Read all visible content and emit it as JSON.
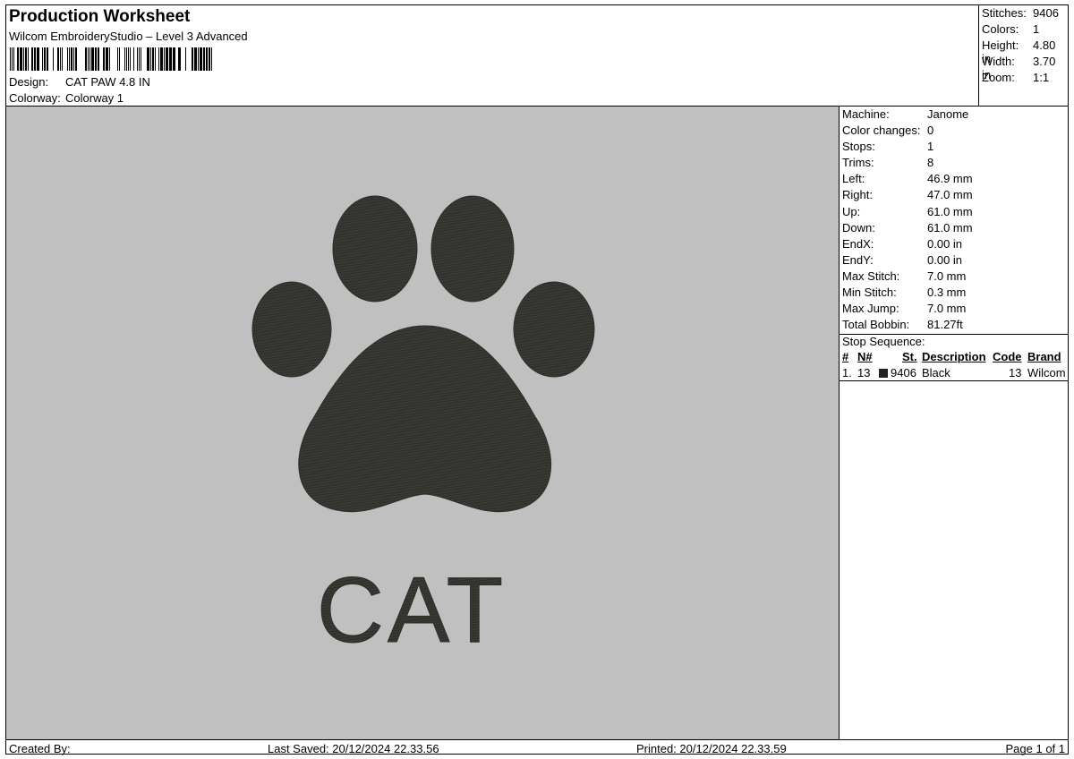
{
  "header": {
    "title": "Production Worksheet",
    "software": "Wilcom EmbroideryStudio – Level 3 Advanced",
    "design_label": "Design:",
    "design_value": "CAT PAW 4.8 IN",
    "colorway_label": "Colorway:",
    "colorway_value": "Colorway 1"
  },
  "stats": [
    {
      "label": "Stitches:",
      "value": "9406"
    },
    {
      "label": "Colors:",
      "value": "1"
    },
    {
      "label": "Height:",
      "value": "4.80 in"
    },
    {
      "label": "Width:",
      "value": "3.70 in"
    },
    {
      "label": "Zoom:",
      "value": "1:1"
    }
  ],
  "params": [
    {
      "label": "Machine:",
      "value": "Janome"
    },
    {
      "label": "Color changes:",
      "value": "0"
    },
    {
      "label": "Stops:",
      "value": "1"
    },
    {
      "label": "Trims:",
      "value": "8"
    },
    {
      "label": "Left:",
      "value": "46.9 mm"
    },
    {
      "label": "Right:",
      "value": "47.0 mm"
    },
    {
      "label": "Up:",
      "value": "61.0 mm"
    },
    {
      "label": "Down:",
      "value": "61.0 mm"
    },
    {
      "label": "EndX:",
      "value": "0.00 in"
    },
    {
      "label": "EndY:",
      "value": "0.00 in"
    },
    {
      "label": "Max Stitch:",
      "value": "7.0 mm"
    },
    {
      "label": "Min Stitch:",
      "value": "0.3 mm"
    },
    {
      "label": "Max Jump:",
      "value": "7.0 mm"
    },
    {
      "label": "Total Bobbin:",
      "value": "81.27ft"
    }
  ],
  "stop_sequence": {
    "title": "Stop Sequence:",
    "headers": {
      "num": "#",
      "n": "N#",
      "st": "St.",
      "description": "Description",
      "code": "Code",
      "brand": "Brand"
    },
    "rows": [
      {
        "num": "1.",
        "n": "13",
        "st": "9406",
        "description": "Black",
        "code": "13",
        "brand": "Wilcom",
        "color": "#222222"
      }
    ]
  },
  "design_preview": {
    "text": "CAT",
    "thread_color": "#3a3a35",
    "background": "#c0c0c0"
  },
  "footer": {
    "created_by": "Created By:",
    "last_saved": "Last Saved: 20/12/2024 22.33.56",
    "printed": "Printed: 20/12/2024 22.33.59",
    "page": "Page 1 of 1"
  }
}
